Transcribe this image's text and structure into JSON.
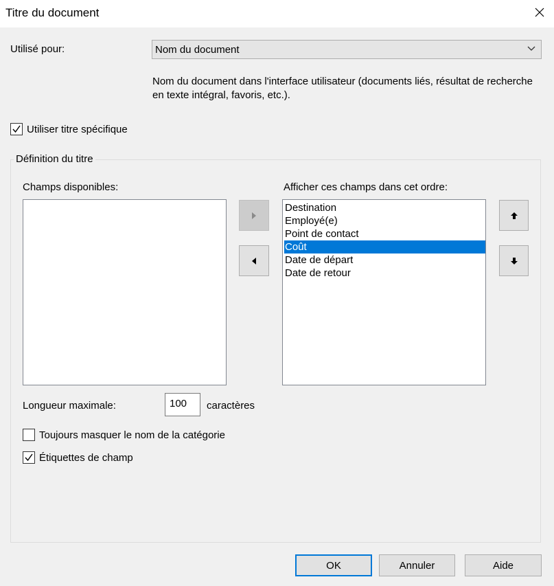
{
  "window": {
    "title": "Titre du document"
  },
  "used_for": {
    "label": "Utilisé pour:",
    "selected": "Nom du document",
    "description": "Nom du document dans l'interface utilisateur (documents liés, résultat de recherche en texte intégral, favoris, etc.)."
  },
  "specific_title": {
    "label": "Utiliser titre spécifique",
    "checked": true
  },
  "definition": {
    "legend": "Définition du titre",
    "available_label": "Champs disponibles:",
    "available_fields": [],
    "order_label": "Afficher ces champs dans cet ordre:",
    "order_fields": [
      "Destination",
      "Employé(e)",
      "Point de contact",
      "Coût",
      "Date de départ",
      "Date de retour"
    ],
    "selected_field": "Coût",
    "max_length_label": "Longueur maximale:",
    "max_length_value": "100",
    "max_length_unit": "caractères",
    "hide_category": {
      "label": "Toujours masquer le nom de la catégorie",
      "checked": false
    },
    "field_labels": {
      "label": "Étiquettes de champ",
      "checked": true
    }
  },
  "icons": {
    "close": "close-icon",
    "chevron": "chevron-down-icon",
    "add": "arrow-right-icon",
    "remove": "arrow-left-icon",
    "up": "arrow-up-icon",
    "down": "arrow-down-icon"
  },
  "buttons": {
    "ok": "OK",
    "cancel": "Annuler",
    "help": "Aide"
  },
  "colors": {
    "selection": "#0078d7",
    "window_bg": "#f0f0f0"
  }
}
